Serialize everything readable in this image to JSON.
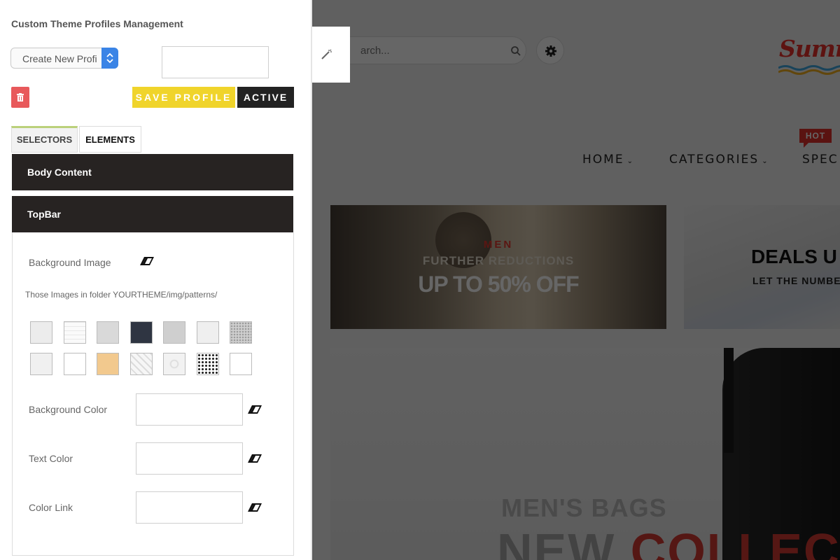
{
  "panel": {
    "title": "Custom Theme Profiles Management",
    "profile_select_value": "Create New Profi",
    "save_label": "SAVE PROFILE",
    "active_label": "ACTIVE",
    "tabs": [
      {
        "label": "SELECTORS",
        "selected": true
      },
      {
        "label": "ELEMENTS",
        "selected": false
      }
    ],
    "sections": [
      "Body Content",
      "TopBar"
    ],
    "topbar": {
      "background_image_label": "Background Image",
      "patterns_note": "Those Images in folder YOURTHEME/img/patterns/",
      "background_color_label": "Background Color",
      "text_color_label": "Text Color",
      "color_link_label": "Color Link"
    },
    "patterns": [
      "marble-light",
      "grid-light",
      "stone-gray",
      "dark-navy",
      "gray-noise",
      "light-crinkle",
      "fine-dots",
      "light-paper",
      "white",
      "wood-light",
      "diagonal-stripes",
      "circles-light",
      "black-dots",
      "plain-white"
    ]
  },
  "store": {
    "search_placeholder": "arch...",
    "logo_text": "Sumr",
    "nav": [
      {
        "label": "HOME"
      },
      {
        "label": "CATEGORIES"
      },
      {
        "label": "SPEC"
      }
    ],
    "hot_badge": "HOT",
    "banner1": {
      "tag": "MEN",
      "line1": "FURTHER REDUCTIONS",
      "line2": "UP TO 50% OFF"
    },
    "banner2": {
      "line1": "DEALS U",
      "line2": "LET THE NUMBE"
    },
    "hero": {
      "line1": "MEN'S BAGS",
      "line2_a": "NEW ",
      "line2_b": "COLLEC"
    }
  },
  "colors": {
    "save_yellow": "#f0d42b",
    "trash_red": "#e8595b",
    "select_blue": "#3a84e6",
    "section_dark": "#272322",
    "brand_red": "#e0312c"
  }
}
